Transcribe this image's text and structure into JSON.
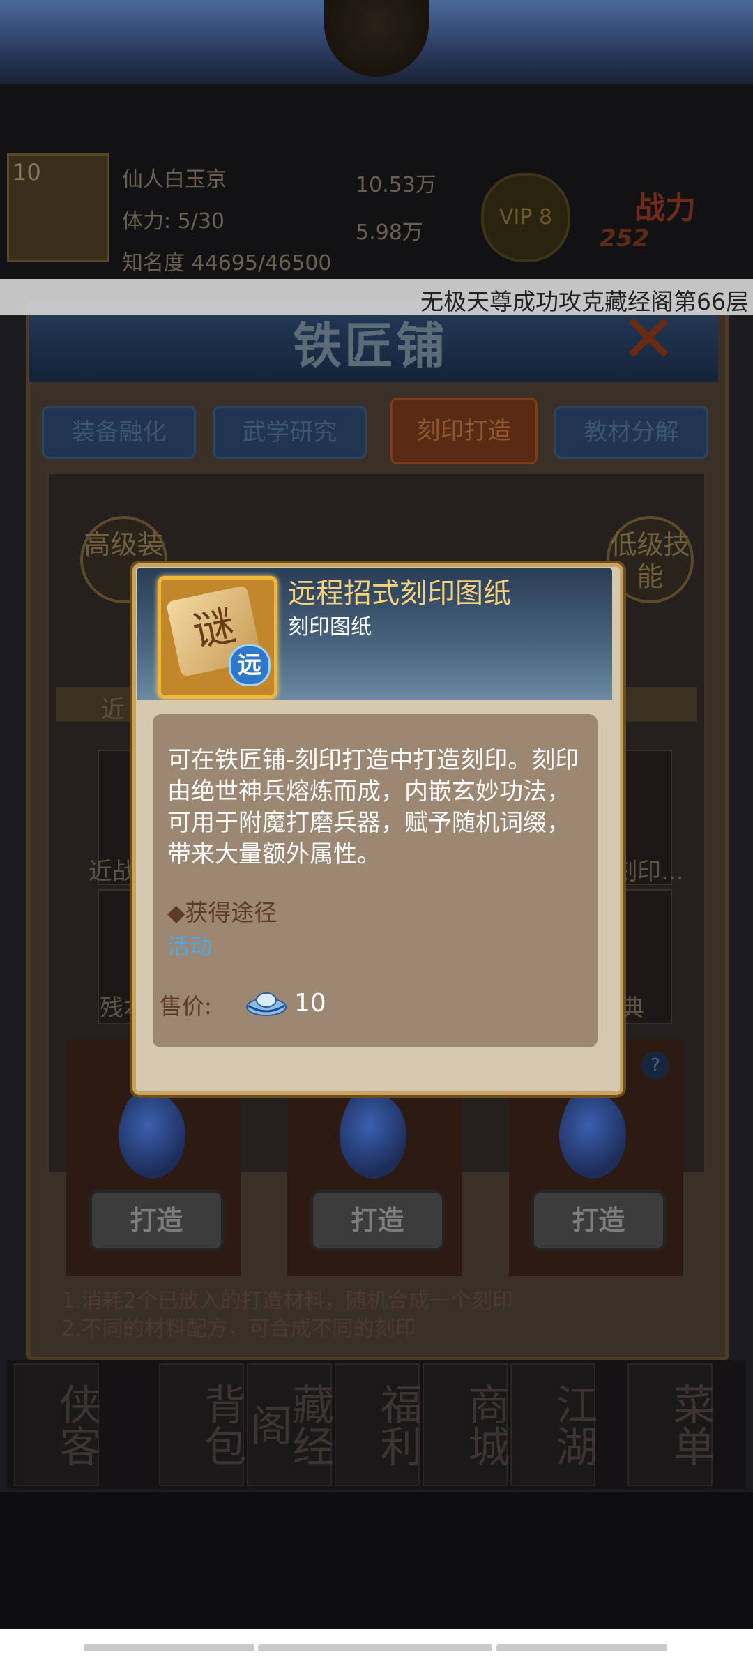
{
  "hud": {
    "level": "10",
    "name": "仙人白玉京",
    "stamina": "体力: 5/30",
    "fame": "知名度 44695/46500",
    "silver": "10.53万",
    "gold": "5.98万",
    "vip": "VIP 8",
    "power_label": "战力",
    "power_value": "252"
  },
  "announcement": "无极天尊成功攻克藏经阁第66层",
  "smithy": {
    "title": "铁匠铺",
    "tabs": [
      "装备融化",
      "武学研究",
      "刻印打造",
      "教材分解"
    ],
    "advanced_badge": "高级装",
    "low_badge": "低级技能",
    "band_label": "近",
    "slot_labels": [
      "近战",
      "刻印...",
      "残本",
      "典"
    ],
    "forge_buttons": [
      "打造",
      "打造",
      "打造"
    ],
    "help": "?",
    "tips": [
      "1.消耗2个已放入的打造材料，随机合成一个刻印",
      "2.不同的材料配方，可合成不同的刻印"
    ]
  },
  "bottom_nav": [
    "侠客",
    "背包",
    "藏经阁",
    "福利",
    "商城",
    "江湖",
    "菜单"
  ],
  "popup": {
    "icon_glyph": "谜",
    "icon_badge": "远",
    "title": "远程招式刻印图纸",
    "type": "刻印图纸",
    "description": "可在铁匠铺-刻印打造中打造刻印。刻印由绝世神兵熔炼而成，内嵌玄妙功法，可用于附魔打磨兵器，赋予随机词缀，带来大量额外属性。",
    "source_heading": "◆获得途径",
    "source_activity": "活动",
    "price_label": "售价:",
    "price_value": "10",
    "currency_icon": "silver-ingot-icon"
  }
}
